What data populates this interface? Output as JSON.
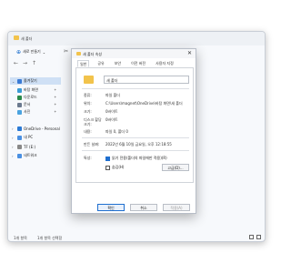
{
  "explorer": {
    "title": "새 폴더",
    "toolbar": {
      "new_label": "새로 만들기",
      "new_chevron": "⌄"
    },
    "sidebar": {
      "items": [
        {
          "label": "즐겨찾기",
          "color": "#3a7bd5"
        },
        {
          "label": "바탕 화면",
          "color": "#3a9bd5"
        },
        {
          "label": "다운로드",
          "color": "#2a8a4a"
        },
        {
          "label": "문서",
          "color": "#6b7a8f"
        },
        {
          "label": "사진",
          "color": "#4aa3df"
        },
        {
          "label": "OneDrive - Personal",
          "color": "#2a7ad5"
        },
        {
          "label": "내 PC",
          "color": "#4a90e2"
        },
        {
          "label": "TF (E:)",
          "color": "#888888"
        },
        {
          "label": "네트워크",
          "color": "#4a90e2"
        }
      ]
    },
    "status": {
      "count": "1개 항목",
      "selected": "1개 항목 선택함"
    }
  },
  "dialog": {
    "title": "새 폴더 속성",
    "close": "✕",
    "tabs": [
      "일반",
      "공유",
      "보안",
      "이전 버전",
      "사용자 지정"
    ],
    "folder_name": "새 폴더",
    "rows": [
      {
        "label": "종류:",
        "value": "파일 폴더"
      },
      {
        "label": "위치:",
        "value": "C:\\Users\\magnet\\OneDrive\\바탕 화면\\새 폴더"
      },
      {
        "label": "크기:",
        "value": "0바이트"
      },
      {
        "label": "디스크 할당 크기:",
        "value": "0바이트"
      },
      {
        "label": "내용:",
        "value": "파일 0, 폴더 0"
      },
      {
        "label": "만든 날짜:",
        "value": "2022년 6월 10일 금요일, 오후 12:18:55"
      }
    ],
    "attributes_label": "특성:",
    "readonly_label": "읽기 전용(폴더의 파일에만 적용)(R)",
    "hidden_label": "숨김(H)",
    "advanced_label": "고급(D)...",
    "ok_label": "확인",
    "cancel_label": "취소",
    "apply_label": "적용(A)"
  }
}
